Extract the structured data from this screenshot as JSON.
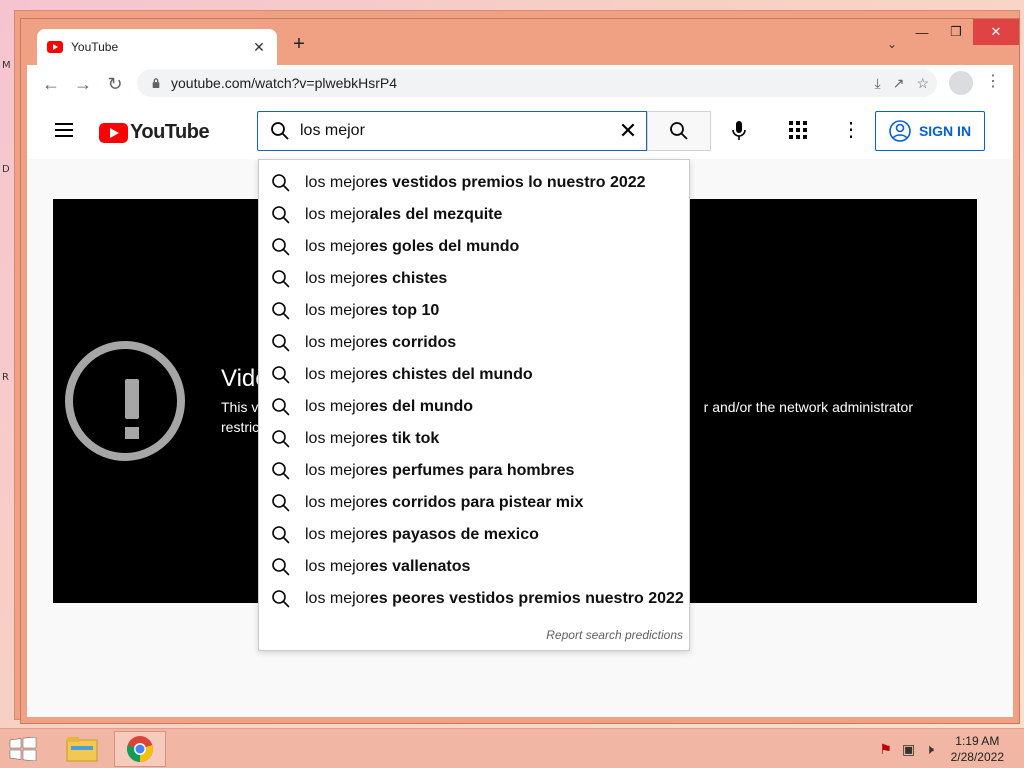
{
  "browser": {
    "tab_title": "YouTube",
    "url": "youtube.com/watch?v=plwebkHsrP4"
  },
  "youtube": {
    "logo_text": "YouTube",
    "search_value": "los mejor",
    "sign_in_label": "SIGN IN"
  },
  "player": {
    "title": "Vide",
    "message_line1": "This v",
    "message_line1_end": "r and/or the network administrator",
    "message_line2": "restric"
  },
  "suggestions": {
    "items": [
      {
        "prefix": "los mejor",
        "rest": "es vestidos premios lo nuestro 2022"
      },
      {
        "prefix": "los mejor",
        "rest": "ales del mezquite"
      },
      {
        "prefix": "los mejor",
        "rest": "es goles del mundo"
      },
      {
        "prefix": "los mejor",
        "rest": "es chistes"
      },
      {
        "prefix": "los mejor",
        "rest": "es top 10"
      },
      {
        "prefix": "los mejor",
        "rest": "es corridos"
      },
      {
        "prefix": "los mejor",
        "rest": "es chistes del mundo"
      },
      {
        "prefix": "los mejor",
        "rest": "es del mundo"
      },
      {
        "prefix": "los mejor",
        "rest": "es tik tok"
      },
      {
        "prefix": "los mejor",
        "rest": "es perfumes para hombres"
      },
      {
        "prefix": "los mejor",
        "rest": "es corridos para pistear mix"
      },
      {
        "prefix": "los mejor",
        "rest": "es payasos de mexico"
      },
      {
        "prefix": "los mejor",
        "rest": "es vallenatos"
      },
      {
        "prefix": "los mejor",
        "rest": "es peores vestidos premios nuestro 2022"
      }
    ],
    "report_label": "Report search predictions"
  },
  "taskbar": {
    "time": "1:19 AM",
    "date": "2/28/2022"
  },
  "colors": {
    "accent_blue": "#065fd4",
    "youtube_red": "#ff0000",
    "chrome_frame": "#f0a184"
  }
}
